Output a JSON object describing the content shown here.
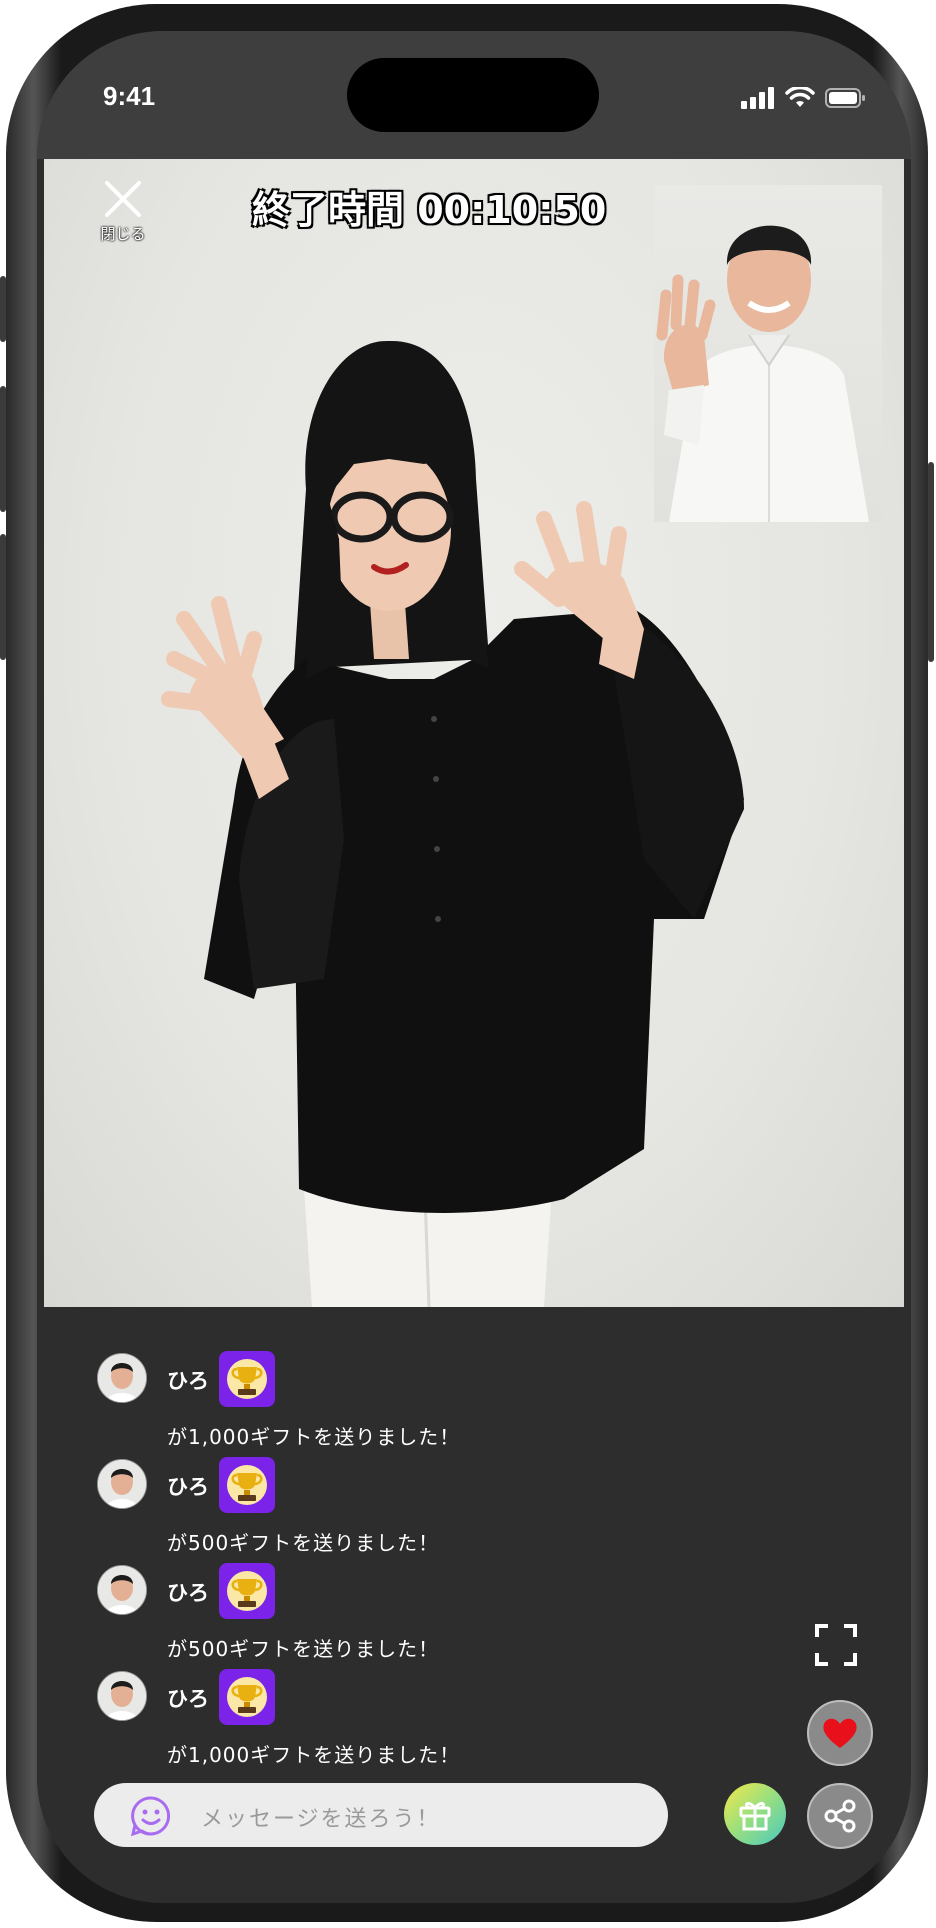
{
  "status_bar": {
    "time": "9:41"
  },
  "call": {
    "close_label": "閉じる",
    "end_time_label": "終了時間 00:10:50"
  },
  "chat": {
    "messages": [
      {
        "username": "ひろ",
        "text": "が1,000ギフトを送りました！"
      },
      {
        "username": "ひろ",
        "text": "が500ギフトを送りました！"
      },
      {
        "username": "ひろ",
        "text": "が500ギフトを送りました！"
      },
      {
        "username": "ひろ",
        "text": "が1,000ギフトを送りました！"
      }
    ]
  },
  "composer": {
    "placeholder": "メッセージを送ろう！"
  },
  "colors": {
    "badge": "#7b23e8",
    "heart": "#e8101a",
    "emoji_icon": "#a96cf0"
  },
  "icons": [
    "close-icon",
    "signal-icon",
    "wifi-icon",
    "battery-icon",
    "trophy-icon",
    "expand-icon",
    "heart-icon",
    "gift-icon",
    "share-icon",
    "emoji-icon"
  ]
}
